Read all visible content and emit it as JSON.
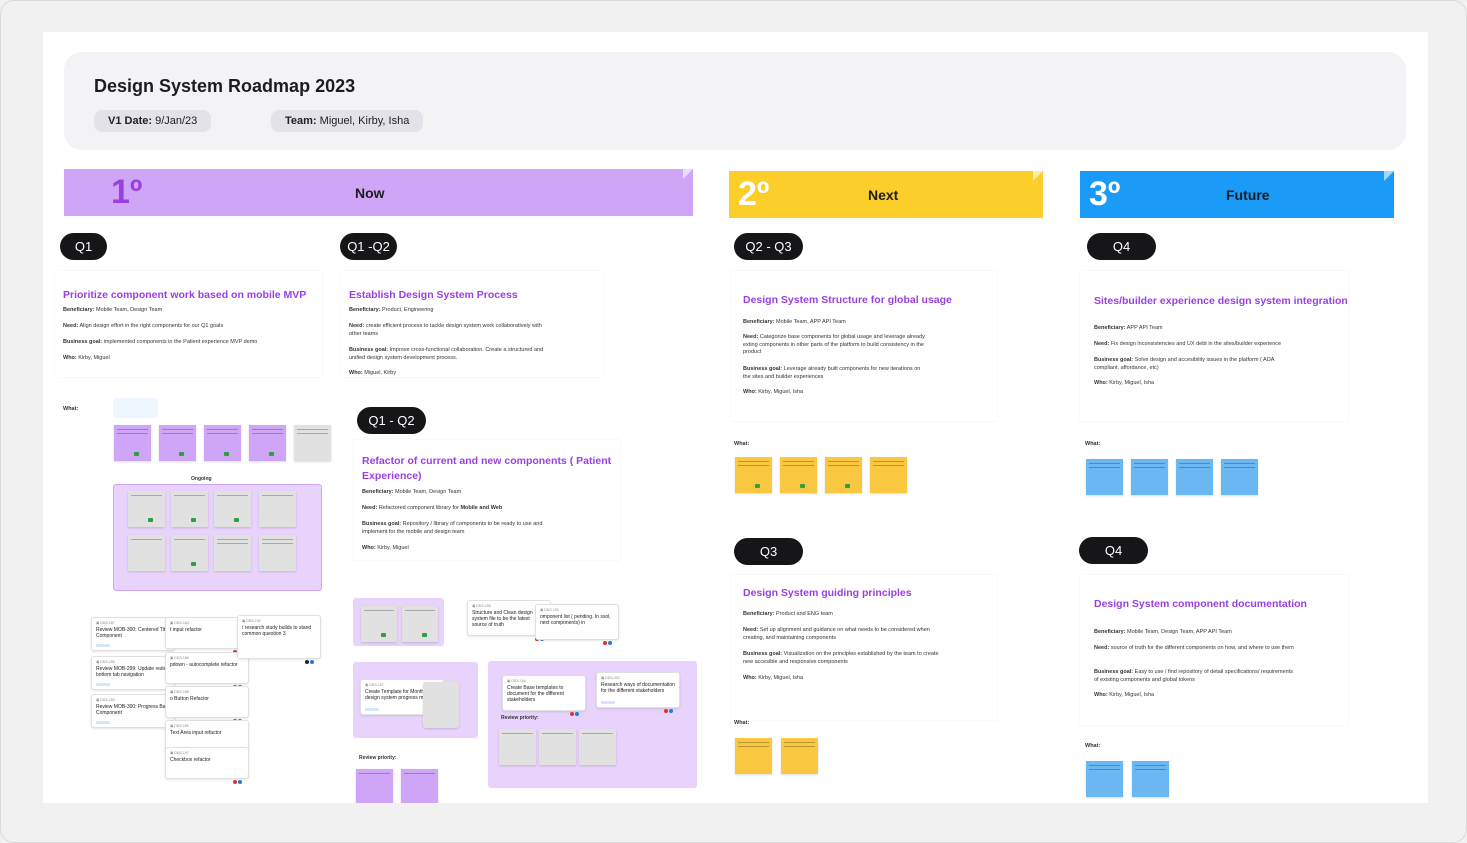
{
  "header": {
    "title": "Design System Roadmap 2023",
    "date_label": "V1 Date:",
    "date_value": "9/Jan/23",
    "team_label": "Team:",
    "team_value": "Miguel, Kirby, Isha"
  },
  "bands": [
    {
      "num": "1º",
      "label": "Now",
      "color": "#cfa6f7",
      "num_color": "#9b3fe0"
    },
    {
      "num": "2º",
      "label": "Next",
      "color": "#fcce2a",
      "num_color": "#ffffff"
    },
    {
      "num": "3º",
      "label": "Future",
      "color": "#1a9bf7",
      "num_color": "#ffffff"
    }
  ],
  "pills": [
    "Q1",
    "Q1 -Q2",
    "Q1 - Q2",
    "Q2 - Q3",
    "Q3",
    "Q4",
    "Q4"
  ],
  "cards": [
    {
      "title": "Prioritize component work based on mobile MVP",
      "beneficiary_label": "Beneficiary:",
      "beneficiary": "Mobile Team, Design Team",
      "need_label": "Need:",
      "need": "Align design effort in the right components for our Q1 goals",
      "goal_label": "Business goal:",
      "goal": "implemented components in the Patient experience MVP demo",
      "who_label": "Who:",
      "who": "Kirby, Miguel"
    },
    {
      "title": "Establish Design System Process",
      "beneficiary_label": "Beneficiary:",
      "beneficiary": "Product, Engineering",
      "need_label": "Need:",
      "need": "create efficient process to tackle design system work collaboratively with other teams",
      "goal_label": "Business goal:",
      "goal": "Improve cross-functional collaboration. Create a structured and unified design system development process.",
      "who_label": "Who:",
      "who": "Miguel, Kirby"
    },
    {
      "title": "Refactor of current and new components ( Patient Experience)",
      "beneficiary_label": "Beneficiary:",
      "beneficiary": "Mobile Team, Design Team",
      "need_label": "Need:",
      "need": "Refactored component library for",
      "need_bold": "Mobile and Web",
      "goal_label": "Business goal:",
      "goal": "Repository / library of components to be ready to use and implement for the mobile and design team",
      "who_label": "Who:",
      "who": "Kirby, Miguel"
    },
    {
      "title": "Design System Structure for global usage",
      "beneficiary_label": "Beneficiary:",
      "beneficiary": "Mobile Team, APP API Team",
      "need_label": "Need:",
      "need": "Categorize base components for global usage and leverage already exting components in other parts of the platform to build consistency in the product",
      "goal_label": "Business goal:",
      "goal": "Leverage already built components for new iterations on the sites and builder experiences",
      "who_label": "Who:",
      "who": "Kirby, Miguel, Isha"
    },
    {
      "title": "Sites/builder experience design system integration",
      "beneficiary_label": "Beneficiary:",
      "beneficiary": "APP API Team",
      "need_label": "Need:",
      "need": "Fix design inconsistencies and UX debt in the sites/builder experience",
      "goal_label": "Business goal:",
      "goal": "Solve design and accesibility issues in the platform ( ADA compliant, affordance, etc)",
      "who_label": "Who:",
      "who": "Kirby, Miguel, Isha"
    },
    {
      "title": "Design System guiding principles",
      "beneficiary_label": "Beneficiary:",
      "beneficiary": "Product and ENG team",
      "need_label": "Need:",
      "need": "Set up alignment and guidance on what needs to be considered when creating, and maintaining components",
      "goal_label": "Business goal:",
      "goal": "Visualization on the principles established by the team to create new accesible and responsive components",
      "who_label": "Who:",
      "who": "Kirby, Miguel, Isha"
    },
    {
      "title": "Design System component documentation",
      "beneficiary_label": "Beneficiary:",
      "beneficiary": "Mobile Team, Design Team, APP API Team",
      "need_label": "Need:",
      "need": "source of truth for the different components on how, and where to use them",
      "goal_label": "Business goal:",
      "goal": "Easy to use / find  repository of detail specifications/ requirements of existing components and global tokens",
      "who_label": "Who:",
      "who": "Kirby, Miguel, Isha"
    }
  ],
  "what_label": "What:",
  "ongoing_label": "Ongoing",
  "review_priority_label": "Review priority:",
  "jira": [
    "Review MOB-300: Centered Title Component",
    "Review MOB-299: Update resle bottom tab navigation",
    "Review MOB-300: Progress Bar Component",
    "t input refactor",
    "pdown - autocomplete refactor",
    "o Button Refactor",
    "Text Area input refactor",
    "Checkbox refactor",
    "/ research study builds to stand common question 3",
    "Structure and Clean design system file to be the latest source of truth",
    "omponent list ( pending. In ssol, next components) in",
    "Create Template for Monthly design system progress meeting",
    "Create Base templates to document for the different stakeholders",
    "Research ways of documentation for the different stakeholders"
  ],
  "colors": {
    "accent_title": "#9b3fe0",
    "pill_bg": "#161618"
  }
}
